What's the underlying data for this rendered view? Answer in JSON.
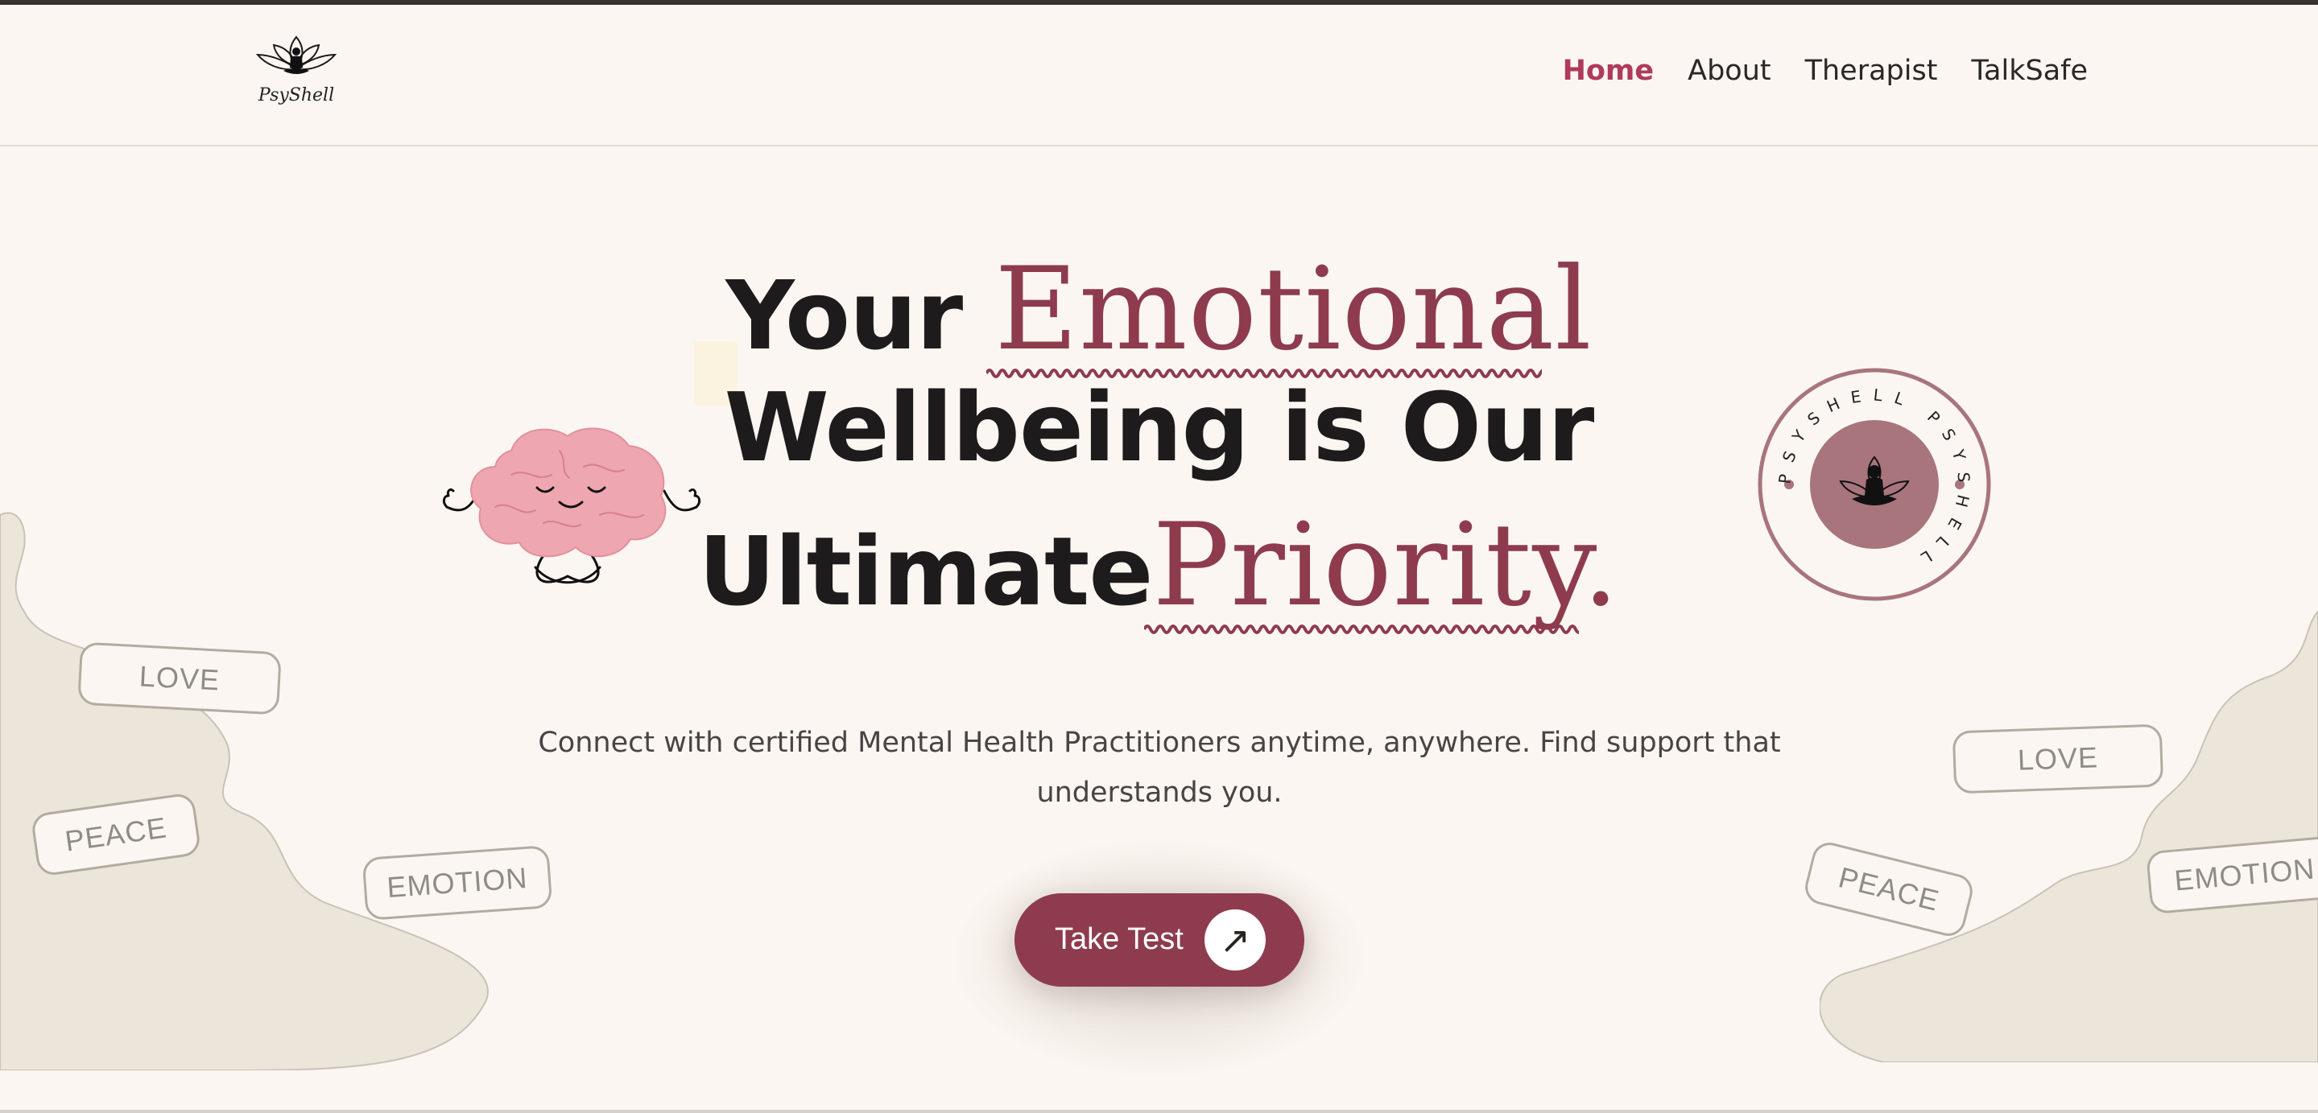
{
  "brand": {
    "logo_text": "PsyShell"
  },
  "nav": {
    "items": [
      {
        "label": "Home",
        "active": true
      },
      {
        "label": "About",
        "active": false
      },
      {
        "label": "Therapist",
        "active": false
      },
      {
        "label": "TalkSafe",
        "active": false
      }
    ]
  },
  "hero": {
    "line1_plain": "Your ",
    "line1_script": "Emotional",
    "line2": "Wellbeing is Our",
    "line3_plain": "Ultimate",
    "line3_script": "Priority.",
    "subtitle": "Connect with certified Mental Health Practitioners anytime, anywhere. Find support that understands you.",
    "cta_label": "Take Test",
    "cta_icon": "arrow-up-right-icon"
  },
  "stamp": {
    "ring_text": "PSYSHELL PSYSHELL"
  },
  "tags": {
    "left": [
      "LOVE",
      "PEACE",
      "EMOTION"
    ],
    "right": [
      "LOVE",
      "PEACE",
      "EMOTION"
    ]
  },
  "colors": {
    "accent": "#8e3b4e",
    "nav_active": "#b03a5b",
    "background": "#fbf6f1",
    "blob": "#ece6da",
    "brain": "#eea6b0"
  }
}
